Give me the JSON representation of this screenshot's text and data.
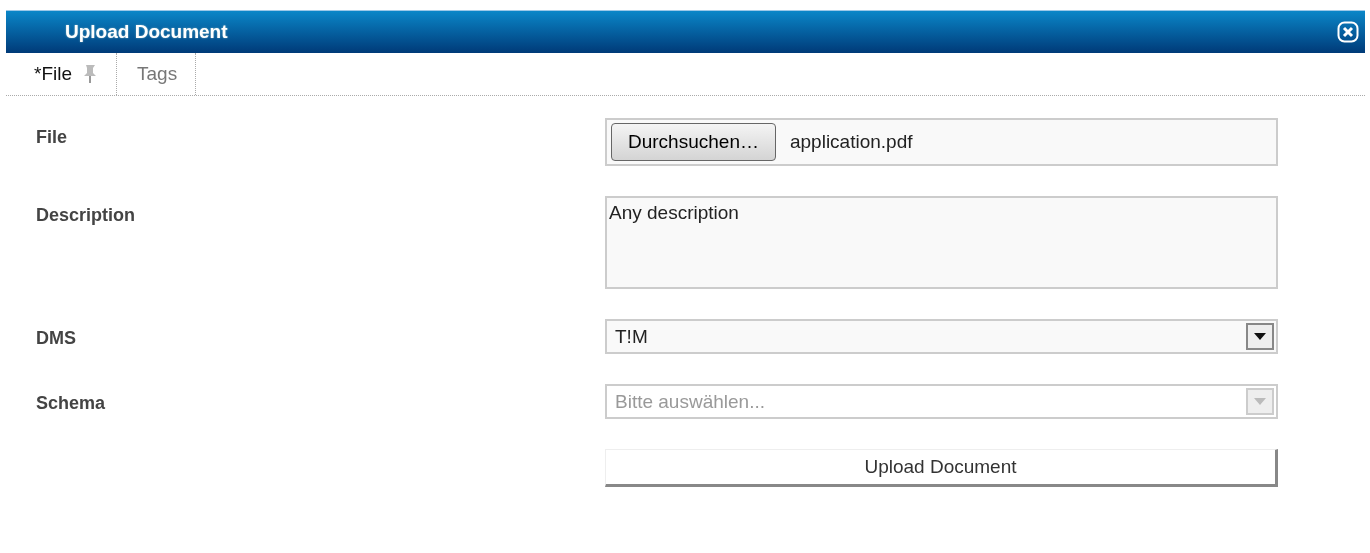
{
  "window": {
    "title": "Upload Document"
  },
  "tabs": [
    {
      "label": "*File",
      "selected": true,
      "pinned": true
    },
    {
      "label": "Tags",
      "selected": false,
      "pinned": false
    }
  ],
  "fields": [
    {
      "kind": "file",
      "label": "File",
      "button": "Durchsuchen…",
      "value": "application.pdf"
    },
    {
      "kind": "textarea",
      "label": "Description",
      "value": "Any description"
    },
    {
      "kind": "select",
      "label": "DMS",
      "value": "T!M",
      "disabled": false
    },
    {
      "kind": "select",
      "label": "Schema",
      "placeholder": "Bitte auswählen...",
      "disabled": true
    }
  ],
  "submit": "Upload Document"
}
